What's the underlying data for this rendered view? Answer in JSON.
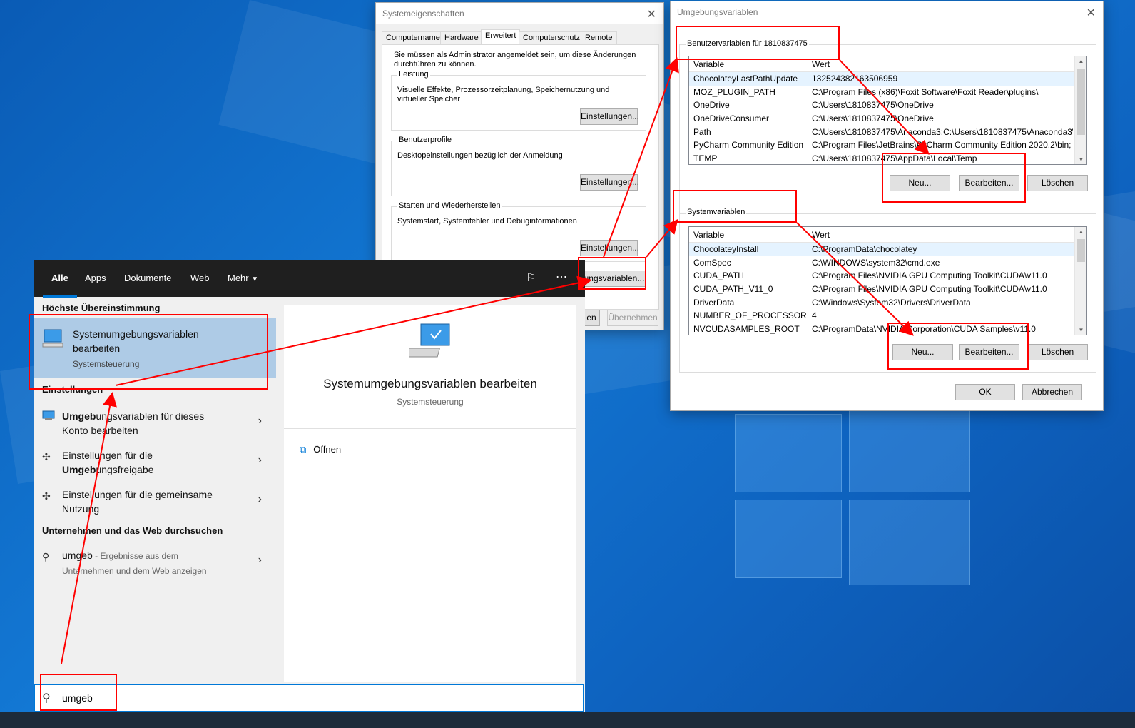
{
  "sysprops": {
    "title": "Systemeigenschaften",
    "tabs": [
      "Computername",
      "Hardware",
      "Erweitert",
      "Computerschutz",
      "Remote"
    ],
    "admin_note": "Sie müssen als Administrator angemeldet sein, um diese Änderungen durchführen zu können.",
    "perf_label": "Leistung",
    "perf_desc": "Visuelle Effekte, Prozessorzeitplanung, Speichernutzung und virtueller Speicher",
    "profiles_label": "Benutzerprofile",
    "profiles_desc": "Desktopeinstellungen bezüglich der Anmeldung",
    "startup_label": "Starten und Wiederherstellen",
    "startup_desc": "Systemstart, Systemfehler und Debuginformationen",
    "settings_btn": "Einstellungen...",
    "env_btn": "ungsvariablen...",
    "cancel_partial": "en",
    "apply_btn": "Übernehmen"
  },
  "envvars": {
    "title": "Umgebungsvariablen",
    "user_group": "Benutzervariablen für 1810837475",
    "sys_group": "Systemvariablen",
    "col_var": "Variable",
    "col_val": "Wert",
    "user_vars": [
      [
        "ChocolateyLastPathUpdate",
        "132524382163506959"
      ],
      [
        "MOZ_PLUGIN_PATH",
        "C:\\Program Files (x86)\\Foxit Software\\Foxit Reader\\plugins\\"
      ],
      [
        "OneDrive",
        "C:\\Users\\1810837475\\OneDrive"
      ],
      [
        "OneDriveConsumer",
        "C:\\Users\\1810837475\\OneDrive"
      ],
      [
        "Path",
        "C:\\Users\\1810837475\\Anaconda3;C:\\Users\\1810837475\\Anaconda3\\..."
      ],
      [
        "PyCharm Community Edition",
        "C:\\Program Files\\JetBrains\\PyCharm Community Edition 2020.2\\bin;"
      ],
      [
        "TEMP",
        "C:\\Users\\1810837475\\AppData\\Local\\Temp"
      ]
    ],
    "sys_vars": [
      [
        "ChocolateyInstall",
        "C:\\ProgramData\\chocolatey"
      ],
      [
        "ComSpec",
        "C:\\WINDOWS\\system32\\cmd.exe"
      ],
      [
        "CUDA_PATH",
        "C:\\Program Files\\NVIDIA GPU Computing Toolkit\\CUDA\\v11.0"
      ],
      [
        "CUDA_PATH_V11_0",
        "C:\\Program Files\\NVIDIA GPU Computing Toolkit\\CUDA\\v11.0"
      ],
      [
        "DriverData",
        "C:\\Windows\\System32\\Drivers\\DriverData"
      ],
      [
        "NUMBER_OF_PROCESSORS",
        "4"
      ],
      [
        "NVCUDASAMPLES_ROOT",
        "C:\\ProgramData\\NVIDIA Corporation\\CUDA Samples\\v11.0"
      ]
    ],
    "new_btn": "Neu...",
    "edit_btn": "Bearbeiten...",
    "delete_btn": "Löschen",
    "ok_btn": "OK",
    "cancel_btn": "Abbrechen"
  },
  "search": {
    "tabs": [
      "Alle",
      "Apps",
      "Dokumente",
      "Web",
      "Mehr"
    ],
    "best_match_heading": "Höchste Übereinstimmung",
    "best_title_1": "Systemumgebungsvariablen",
    "best_title_2": "bearbeiten",
    "best_sub": "Systemsteuerung",
    "settings_heading": "Einstellungen",
    "item1_bold": "Umgeb",
    "item1_rest": "ungsvariablen für dieses",
    "item1_line2": "Konto bearbeiten",
    "item2_line1": "Einstellungen für die",
    "item2_bold": "Umgeb",
    "item2_rest": "ungsfreigabe",
    "item3_line1": "Einstellungen für die gemeinsame",
    "item3_line2": "Nutzung",
    "web_heading": "Unternehmen und das Web durchsuchen",
    "web_query": "umgeb",
    "web_suffix": " - Ergebnisse aus dem",
    "web_line2": "Unternehmen und dem Web anzeigen",
    "preview_title": "Systemumgebungsvariablen bearbeiten",
    "preview_sub": "Systemsteuerung",
    "open_label": "Öffnen",
    "query": "umgeb"
  },
  "colors": {
    "accent": "#0078d7",
    "annotation": "#ff0000",
    "selection": "#aecbe6"
  }
}
